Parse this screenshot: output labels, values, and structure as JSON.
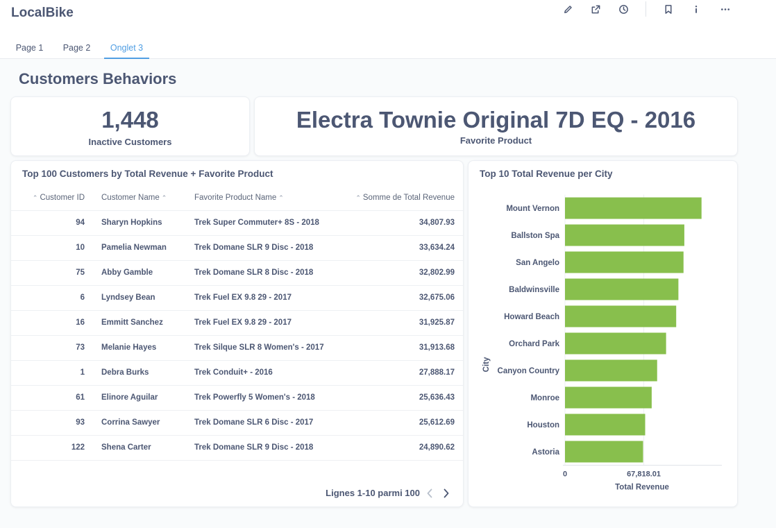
{
  "app": {
    "title": "LocalBike"
  },
  "toolbar": [
    {
      "name": "edit-icon"
    },
    {
      "name": "share-icon"
    },
    {
      "name": "clock-icon"
    },
    {
      "name": "bookmark-icon"
    },
    {
      "name": "info-icon"
    },
    {
      "name": "more-icon"
    }
  ],
  "tabs": [
    {
      "label": "Page 1",
      "active": false
    },
    {
      "label": "Page 2",
      "active": false
    },
    {
      "label": "Onglet 3",
      "active": true
    }
  ],
  "section": {
    "title": "Customers Behaviors"
  },
  "scalars": {
    "inactive": {
      "value": "1,448",
      "label": "Inactive Customers"
    },
    "favorite": {
      "value": "Electra Townie Original 7D EQ - 2016",
      "label": "Favorite Product"
    }
  },
  "table": {
    "title": "Top 100 Customers by Total Revenue + Favorite Product",
    "columns": [
      "Customer ID",
      "Customer Name",
      "Favorite Product Name",
      "Somme de Total Revenue"
    ],
    "rows": [
      [
        "94",
        "Sharyn Hopkins",
        "Trek Super Commuter+ 8S - 2018",
        "34,807.93"
      ],
      [
        "10",
        "Pamelia Newman",
        "Trek Domane SLR 9 Disc - 2018",
        "33,634.24"
      ],
      [
        "75",
        "Abby Gamble",
        "Trek Domane SLR 8 Disc - 2018",
        "32,802.99"
      ],
      [
        "6",
        "Lyndsey Bean",
        "Trek Fuel EX 9.8 29 - 2017",
        "32,675.06"
      ],
      [
        "16",
        "Emmitt Sanchez",
        "Trek Fuel EX 9.8 29 - 2017",
        "31,925.87"
      ],
      [
        "73",
        "Melanie Hayes",
        "Trek Silque SLR 8 Women's - 2017",
        "31,913.68"
      ],
      [
        "1",
        "Debra Burks",
        "Trek Conduit+ - 2016",
        "27,888.17"
      ],
      [
        "61",
        "Elinore Aguilar",
        "Trek Powerfly 5 Women's - 2018",
        "25,636.43"
      ],
      [
        "93",
        "Corrina Sawyer",
        "Trek Domane SLR 6 Disc - 2017",
        "25,612.69"
      ],
      [
        "122",
        "Shena Carter",
        "Trek Domane SLR 9 Disc - 2018",
        "24,890.62"
      ]
    ],
    "pagination": "Lignes 1-10 parmi 100"
  },
  "chart": {
    "title": "Top 10 Total Revenue per City",
    "chart_data": {
      "type": "bar",
      "orientation": "horizontal",
      "title": "Top 10 Total Revenue per City",
      "xlabel": "Total Revenue",
      "ylabel": "City",
      "categories": [
        "Mount Vernon",
        "Ballston Spa",
        "San Angelo",
        "Baldwinsville",
        "Howard Beach",
        "Orchard Park",
        "Canyon Country",
        "Monroe",
        "Houston",
        "Astoria"
      ],
      "values": [
        117500,
        102700,
        102000,
        97600,
        95700,
        87000,
        79300,
        74600,
        69000,
        67200
      ],
      "xticks": [
        0,
        67818.01
      ],
      "xtick_labels": [
        "0",
        "67,818.01"
      ],
      "xlim": [
        0,
        135000
      ],
      "bar_color": "#88bf4d",
      "grid": true
    }
  }
}
